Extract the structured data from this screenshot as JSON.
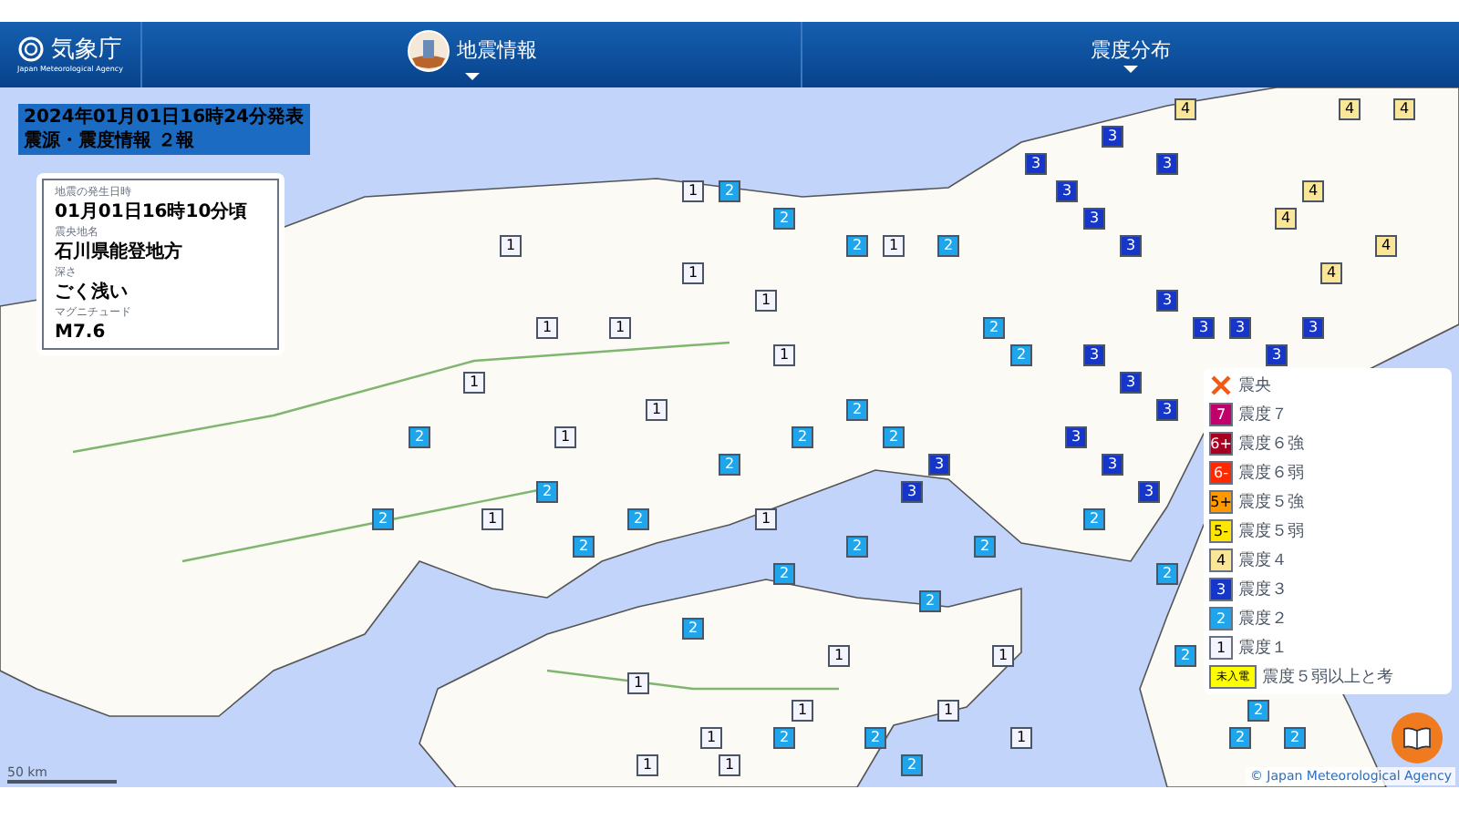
{
  "header": {
    "logo_text": "気象庁",
    "logo_subtext": "Japan Meteorological Agency",
    "menus": [
      {
        "label": "地震情報",
        "kind": "icon"
      },
      {
        "label": "震度分布",
        "kind": "plain"
      }
    ]
  },
  "announcement": {
    "issued": "2024年01月01日16時24分発表",
    "report": "震源・震度情報 ２報"
  },
  "quake_info": [
    {
      "label": "地震の発生日時",
      "value": "01月01日16時10分頃"
    },
    {
      "label": "震央地名",
      "value": "石川県能登地方"
    },
    {
      "label": "深さ",
      "value": "ごく浅い"
    },
    {
      "label": "マグニチュード",
      "value": "M7.6"
    }
  ],
  "markers": [
    {
      "label": "4",
      "color": "#fae696"
    },
    {
      "label": "4",
      "color": "#fae696"
    },
    {
      "label": "4",
      "color": "#fae696"
    },
    {
      "label": "3",
      "color": "#1536c9"
    },
    {
      "label": "3",
      "color": "#1536c9"
    },
    {
      "label": "3",
      "color": "#1536c9"
    },
    {
      "label": "1",
      "color": "#f4f4ff"
    },
    {
      "label": "2",
      "color": "#1ea5ec"
    },
    {
      "label": "3",
      "color": "#1536c9"
    },
    {
      "label": "4",
      "color": "#fae696"
    },
    {
      "label": "2",
      "color": "#1ea5ec"
    },
    {
      "label": "3",
      "color": "#1536c9"
    },
    {
      "label": "4",
      "color": "#fae696"
    },
    {
      "label": "1",
      "color": "#f4f4ff"
    },
    {
      "label": "2",
      "color": "#1ea5ec"
    },
    {
      "label": "1",
      "color": "#f4f4ff"
    },
    {
      "label": "2",
      "color": "#1ea5ec"
    },
    {
      "label": "3",
      "color": "#1536c9"
    },
    {
      "label": "4",
      "color": "#fae696"
    },
    {
      "label": "1",
      "color": "#f4f4ff"
    },
    {
      "label": "4",
      "color": "#fae696"
    },
    {
      "label": "1",
      "color": "#f4f4ff"
    },
    {
      "label": "3",
      "color": "#1536c9"
    },
    {
      "label": "1",
      "color": "#f4f4ff"
    },
    {
      "label": "1",
      "color": "#f4f4ff"
    },
    {
      "label": "2",
      "color": "#1ea5ec"
    },
    {
      "label": "3",
      "color": "#1536c9"
    },
    {
      "label": "3",
      "color": "#1536c9"
    },
    {
      "label": "3",
      "color": "#1536c9"
    },
    {
      "label": "1",
      "color": "#f4f4ff"
    },
    {
      "label": "2",
      "color": "#1ea5ec"
    },
    {
      "label": "3",
      "color": "#1536c9"
    },
    {
      "label": "3",
      "color": "#1536c9"
    },
    {
      "label": "1",
      "color": "#f4f4ff"
    },
    {
      "label": "3",
      "color": "#1536c9"
    },
    {
      "label": "1",
      "color": "#f4f4ff"
    },
    {
      "label": "2",
      "color": "#1ea5ec"
    },
    {
      "label": "3",
      "color": "#1536c9"
    },
    {
      "label": "2",
      "color": "#1ea5ec"
    },
    {
      "label": "1",
      "color": "#f4f4ff"
    },
    {
      "label": "2",
      "color": "#1ea5ec"
    },
    {
      "label": "2",
      "color": "#1ea5ec"
    },
    {
      "label": "3",
      "color": "#1536c9"
    },
    {
      "label": "2",
      "color": "#1ea5ec"
    },
    {
      "label": "3",
      "color": "#1536c9"
    },
    {
      "label": "3",
      "color": "#1536c9"
    },
    {
      "label": "2",
      "color": "#1ea5ec"
    },
    {
      "label": "3",
      "color": "#1536c9"
    },
    {
      "label": "3",
      "color": "#1536c9"
    },
    {
      "label": "2",
      "color": "#1ea5ec"
    },
    {
      "label": "1",
      "color": "#f4f4ff"
    },
    {
      "label": "2",
      "color": "#1ea5ec"
    },
    {
      "label": "1",
      "color": "#f4f4ff"
    },
    {
      "label": "2",
      "color": "#1ea5ec"
    },
    {
      "label": "2",
      "color": "#1ea5ec"
    },
    {
      "label": "2",
      "color": "#1ea5ec"
    },
    {
      "label": "2",
      "color": "#1ea5ec"
    },
    {
      "label": "2",
      "color": "#1ea5ec"
    },
    {
      "label": "2",
      "color": "#1ea5ec"
    },
    {
      "label": "2",
      "color": "#1ea5ec"
    },
    {
      "label": "2",
      "color": "#1ea5ec"
    },
    {
      "label": "1",
      "color": "#f4f4ff"
    },
    {
      "label": "1",
      "color": "#f4f4ff"
    },
    {
      "label": "2",
      "color": "#1ea5ec"
    },
    {
      "label": "1",
      "color": "#f4f4ff"
    },
    {
      "label": "1",
      "color": "#f4f4ff"
    },
    {
      "label": "1",
      "color": "#f4f4ff"
    },
    {
      "label": "2",
      "color": "#1ea5ec"
    },
    {
      "label": "1",
      "color": "#f4f4ff"
    },
    {
      "label": "2",
      "color": "#1ea5ec"
    },
    {
      "label": "2",
      "color": "#1ea5ec"
    },
    {
      "label": "1",
      "color": "#f4f4ff"
    },
    {
      "label": "2",
      "color": "#1ea5ec"
    },
    {
      "label": "2",
      "color": "#1ea5ec"
    },
    {
      "label": "1",
      "color": "#f4f4ff"
    },
    {
      "label": "1",
      "color": "#f4f4ff"
    },
    {
      "label": "2",
      "color": "#1ea5ec"
    }
  ],
  "legend": [
    {
      "kind": "epicenter",
      "label": "震央"
    },
    {
      "kind": "chip",
      "chip": "7",
      "color": "#c0006b",
      "label": "震度７"
    },
    {
      "kind": "chip",
      "chip": "6+",
      "color": "#a50021",
      "label": "震度６強"
    },
    {
      "kind": "chip",
      "chip": "6-",
      "color": "#ff2800",
      "label": "震度６弱"
    },
    {
      "kind": "chip",
      "chip": "5+",
      "color": "#ff9900",
      "label": "震度５強"
    },
    {
      "kind": "chip",
      "chip": "5-",
      "color": "#ffe600",
      "label": "震度５弱"
    },
    {
      "kind": "chip",
      "chip": "4",
      "color": "#fae696",
      "label": "震度４"
    },
    {
      "kind": "chip",
      "chip": "3",
      "color": "#1536c9",
      "label": "震度３"
    },
    {
      "kind": "chip",
      "chip": "2",
      "color": "#1ea5ec",
      "label": "震度２"
    },
    {
      "kind": "chip",
      "chip": "1",
      "color": "#f4f4ff",
      "label": "震度１"
    },
    {
      "kind": "wide",
      "chip": "未入電",
      "color": "#ffff00",
      "label": "震度５弱以上と考"
    }
  ],
  "scale": "50 km",
  "copyright": "© Japan Meteorological Agency"
}
